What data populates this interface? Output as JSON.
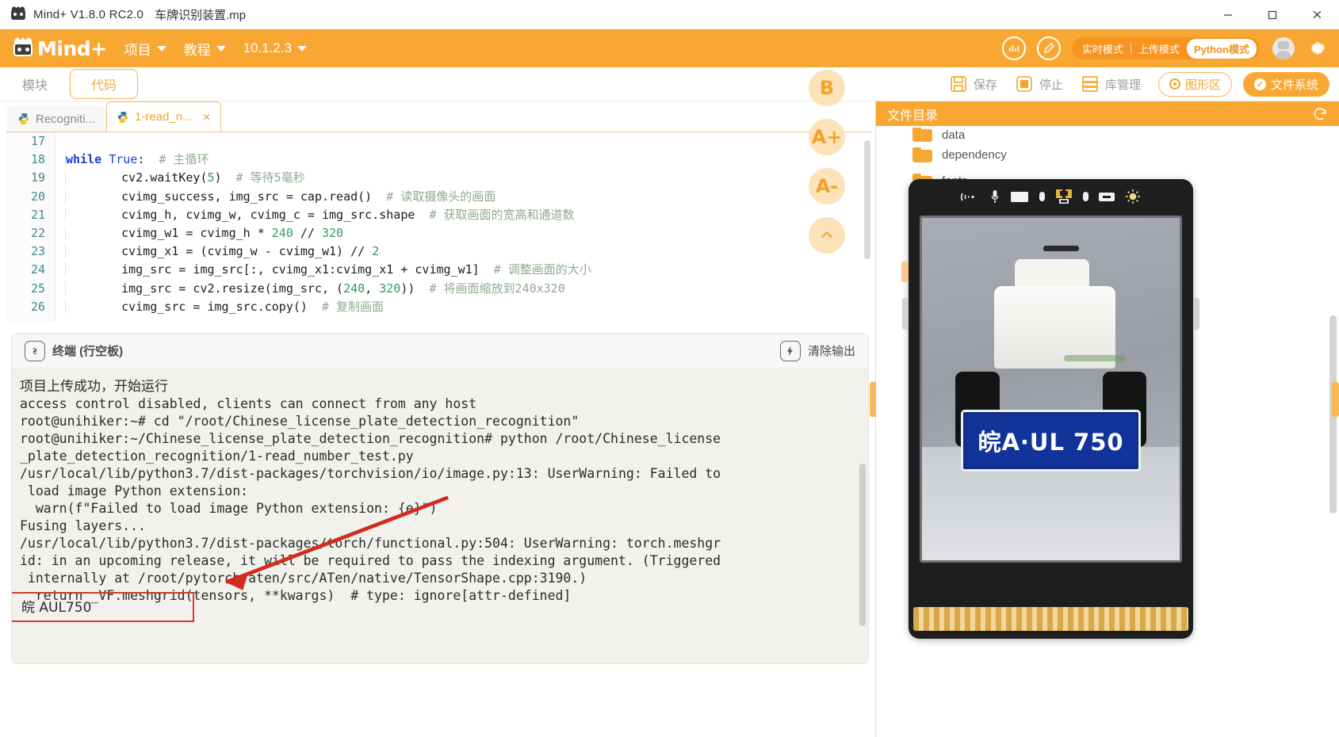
{
  "window": {
    "app_title": "Mind+ V1.8.0 RC2.0",
    "file_name": "车牌识别装置.mp",
    "logo_icon": "mindplus-robot-icon",
    "minimize_icon": "minimize-icon",
    "maximize_icon": "maximize-icon",
    "close_icon": "close-icon"
  },
  "menubar": {
    "brand": "Mind+",
    "items": [
      {
        "label": "项目",
        "icon": "chevron-down-icon"
      },
      {
        "label": "教程",
        "icon": "chevron-down-icon"
      },
      {
        "label": "10.1.2.3",
        "icon": "chevron-down-icon"
      }
    ],
    "right_icons": [
      "chart-circle-icon",
      "edit-circle-icon"
    ],
    "modes": [
      {
        "label": "实时模式",
        "active": false
      },
      {
        "label": "上传模式",
        "active": false
      },
      {
        "label": "Python模式",
        "active": true
      }
    ],
    "avatar_icon": "user-avatar-icon",
    "settings_icon": "gear-icon"
  },
  "toolbar": {
    "tabs": [
      {
        "label": "模块",
        "selected": false
      },
      {
        "label": "代码",
        "selected": true
      }
    ],
    "buttons": [
      {
        "label": "保存",
        "icon": "save-floppy-icon"
      },
      {
        "label": "停止",
        "icon": "stop-square-icon"
      },
      {
        "label": "库管理",
        "icon": "library-drawer-icon"
      }
    ],
    "toggle_outline": {
      "label": "图形区",
      "icon": "radio-dot-icon"
    },
    "toggle_solid": {
      "label": "文件系统",
      "icon": "check-circle-icon"
    }
  },
  "editor": {
    "tabs": [
      {
        "label": "Recogniti...",
        "icon": "python-file-icon",
        "active": false,
        "closable": false
      },
      {
        "label": "1-read_n...",
        "icon": "python-file-icon",
        "active": true,
        "closable": true,
        "close_icon": "close-icon"
      }
    ],
    "float_buttons": [
      {
        "label": "B",
        "name": "bold-format-button"
      },
      {
        "label": "A+",
        "name": "font-increase-button"
      },
      {
        "label": "A-",
        "name": "font-decrease-button"
      },
      {
        "label": "⌃",
        "name": "collapse-button"
      }
    ],
    "first_line_number": 17,
    "lines": [
      {
        "no": 17,
        "indent": 0,
        "tokens": []
      },
      {
        "no": 18,
        "indent": 1,
        "tokens": [
          {
            "t": "kw",
            "s": "while "
          },
          {
            "t": "bi",
            "s": "True"
          },
          {
            "t": "pl",
            "s": ":  "
          },
          {
            "t": "cm",
            "s": "# 主循环"
          }
        ]
      },
      {
        "no": 19,
        "indent": 2,
        "tokens": [
          {
            "t": "pl",
            "s": "cv2.waitKey("
          },
          {
            "t": "num",
            "s": "5"
          },
          {
            "t": "pl",
            "s": ")  "
          },
          {
            "t": "cm",
            "s": "# 等待5毫秒"
          }
        ]
      },
      {
        "no": 20,
        "indent": 2,
        "tokens": [
          {
            "t": "pl",
            "s": "cvimg_success, img_src = cap.read()  "
          },
          {
            "t": "cm",
            "s": "# 读取摄像头的画面"
          }
        ]
      },
      {
        "no": 21,
        "indent": 2,
        "tokens": [
          {
            "t": "pl",
            "s": "cvimg_h, cvimg_w, cvimg_c = img_src.shape  "
          },
          {
            "t": "cm",
            "s": "# 获取画面的宽高和通道数"
          }
        ]
      },
      {
        "no": 22,
        "indent": 2,
        "tokens": [
          {
            "t": "pl",
            "s": "cvimg_w1 = cvimg_h * "
          },
          {
            "t": "num",
            "s": "240"
          },
          {
            "t": "pl",
            "s": " // "
          },
          {
            "t": "num",
            "s": "320"
          }
        ]
      },
      {
        "no": 23,
        "indent": 2,
        "tokens": [
          {
            "t": "pl",
            "s": "cvimg_x1 = (cvimg_w - cvimg_w1) // "
          },
          {
            "t": "num",
            "s": "2"
          }
        ]
      },
      {
        "no": 24,
        "indent": 2,
        "tokens": [
          {
            "t": "pl",
            "s": "img_src = img_src[:, cvimg_x1:cvimg_x1 + cvimg_w1]  "
          },
          {
            "t": "cm",
            "s": "# 调整画面的大小"
          }
        ]
      },
      {
        "no": 25,
        "indent": 2,
        "tokens": [
          {
            "t": "pl",
            "s": "img_src = cv2.resize(img_src, ("
          },
          {
            "t": "num",
            "s": "240"
          },
          {
            "t": "pl",
            "s": ", "
          },
          {
            "t": "num",
            "s": "320"
          },
          {
            "t": "pl",
            "s": "))  "
          },
          {
            "t": "cm",
            "s": "# 将画面缩放到240x320"
          }
        ]
      },
      {
        "no": 26,
        "indent": 2,
        "tokens": [
          {
            "t": "pl",
            "s": "cvimg_src = img_src.copy()  "
          },
          {
            "t": "cm",
            "s": "# 复制画面"
          }
        ]
      }
    ]
  },
  "terminal": {
    "title": "终端 (行空板)",
    "title_icon": "terminal-link-icon",
    "clear_label": "清除输出",
    "clear_icon": "clear-output-icon",
    "output_lines": [
      {
        "text": "项目上传成功，开始运行",
        "cjk": true
      },
      {
        "text": "access control disabled, clients can connect from any host",
        "cjk": false
      },
      {
        "text": "root@unihiker:~# cd \"/root/Chinese_license_plate_detection_recognition\"",
        "cjk": false
      },
      {
        "text": "root@unihiker:~/Chinese_license_plate_detection_recognition# python /root/Chinese_license",
        "cjk": false
      },
      {
        "text": "_plate_detection_recognition/1-read_number_test.py",
        "cjk": false
      },
      {
        "text": "/usr/local/lib/python3.7/dist-packages/torchvision/io/image.py:13: UserWarning: Failed to",
        "cjk": false
      },
      {
        "text": " load image Python extension:",
        "cjk": false
      },
      {
        "text": "  warn(f\"Failed to load image Python extension: {e}\")",
        "cjk": false
      },
      {
        "text": "Fusing layers...",
        "cjk": false
      },
      {
        "text": "/usr/local/lib/python3.7/dist-packages/torch/functional.py:504: UserWarning: torch.meshgr",
        "cjk": false
      },
      {
        "text": "id: in an upcoming release, it will be required to pass the indexing argument. (Triggered",
        "cjk": false
      },
      {
        "text": " internally at /root/pytorch/aten/src/ATen/native/TensorShape.cpp:3190.)",
        "cjk": false
      },
      {
        "text": "  return _VF.meshgrid(tensors, **kwargs)  # type: ignore[attr-defined]",
        "cjk": false
      }
    ],
    "highlight_result": "皖 AUL750",
    "highlight_color": "#d03a30",
    "annotation_arrow_color": "#d42b1f"
  },
  "file_directory": {
    "title": "文件目录",
    "refresh_icon": "refresh-icon",
    "items": [
      {
        "label": "data",
        "icon": "folder-icon"
      },
      {
        "label": "dependency",
        "icon": "folder-icon"
      },
      {
        "label": "fonts",
        "icon": "folder-icon"
      }
    ]
  },
  "device_preview": {
    "name": "unihiker-board-preview",
    "top_icons": [
      "wifi-icon",
      "microphone-icon",
      "display-icon",
      "led-dot-icon",
      "connector-icon",
      "led-dot2-icon",
      "buzzer-icon",
      "light-sensor-icon"
    ],
    "plate_text": "皖A·UL 750",
    "plate_bg": "#12349a",
    "plate_fg": "#ffffff"
  },
  "colors": {
    "brand_orange": "#f8a832",
    "accent_orange": "#f0a52f",
    "code_keyword": "#1a3fd4",
    "code_number": "#2d9b5f",
    "code_comment": "#8faa8f",
    "gutter_number": "#3d8a8a",
    "terminal_bg": "#f2f1ec"
  }
}
